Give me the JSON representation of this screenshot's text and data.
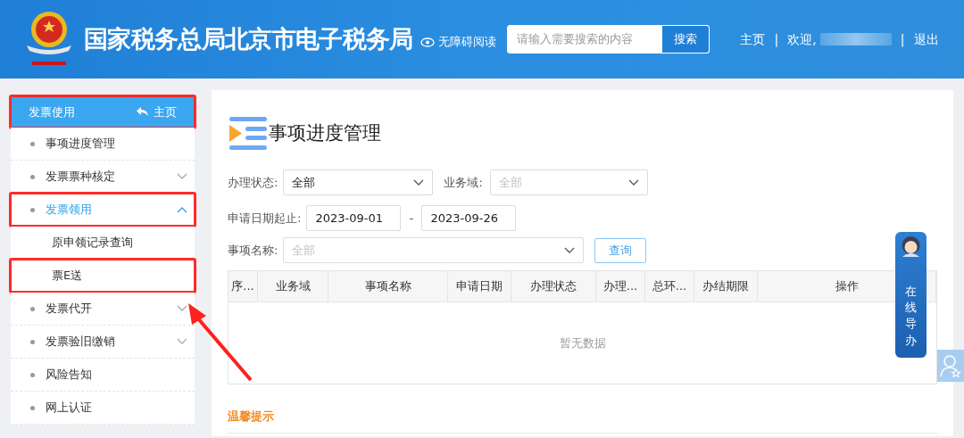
{
  "header": {
    "title": "国家税务总局北京市电子税务局",
    "accessibility": "无障碍阅读",
    "search": {
      "placeholder": "请输入需要搜索的内容",
      "button": "搜索"
    },
    "nav": [
      {
        "kind": "link",
        "label": "主页"
      },
      {
        "kind": "sep",
        "label": "|"
      },
      {
        "kind": "welcome",
        "label": "欢迎,"
      },
      {
        "kind": "sep",
        "label": "|"
      },
      {
        "kind": "link",
        "label": "退出"
      }
    ]
  },
  "sidebar": {
    "title": "发票使用",
    "home": "主页",
    "highlighted": true,
    "items": [
      {
        "label": "事项进度管理",
        "kind": "item",
        "selected": false,
        "highlighted": false
      },
      {
        "label": "发票票种核定",
        "kind": "item",
        "selected": false,
        "expanded": false,
        "highlighted": false
      },
      {
        "label": "发票领用",
        "kind": "item",
        "selected": true,
        "expanded": true,
        "highlighted": true
      },
      {
        "label": "原申领记录查询",
        "kind": "subitem",
        "selected": false,
        "highlighted": false
      },
      {
        "label": "票E送",
        "kind": "subitem",
        "selected": false,
        "highlighted": true
      },
      {
        "label": "发票代开",
        "kind": "item",
        "selected": false,
        "expanded": false,
        "highlighted": false
      },
      {
        "label": "发票验旧缴销",
        "kind": "item",
        "selected": false,
        "expanded": false,
        "highlighted": false
      },
      {
        "label": "风险告知",
        "kind": "item",
        "selected": false,
        "highlighted": false
      },
      {
        "label": "网上认证",
        "kind": "item",
        "selected": false,
        "highlighted": false
      }
    ]
  },
  "main": {
    "title": "事项进度管理",
    "filters": {
      "status_label": "办理状态:",
      "status_value": "全部",
      "domain_label": "业务域:",
      "domain_placeholder": "全部",
      "date_label": "申请日期起止:",
      "date_from": "2023-09-01",
      "date_sep": "-",
      "date_to": "2023-09-26",
      "name_label": "事项名称:",
      "name_placeholder": "全部",
      "query_button": "查询"
    },
    "table": {
      "columns": [
        "序...",
        "业务域",
        "事项名称",
        "申请日期",
        "办理状态",
        "办理...",
        "总环...",
        "办结期限",
        "操作"
      ],
      "empty": "暂无数据"
    },
    "tips_title": "温馨提示"
  },
  "guide_widget": {
    "label": "在线导办"
  }
}
